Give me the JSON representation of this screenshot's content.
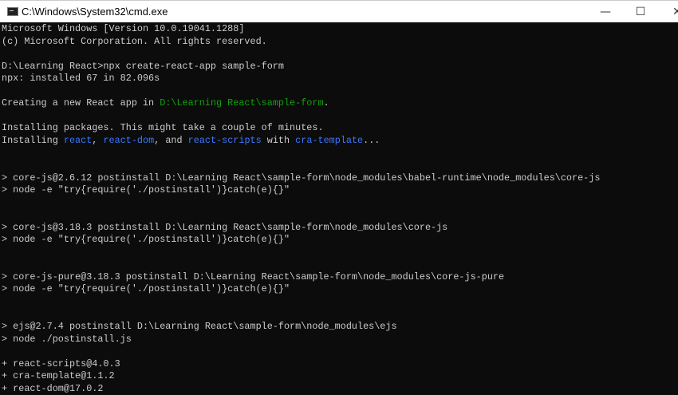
{
  "window": {
    "title": "C:\\Windows\\System32\\cmd.exe",
    "icons": [
      "cmd-icon",
      "minimize-icon",
      "maximize-icon",
      "close-icon"
    ],
    "minimize_glyph": "—",
    "maximize_glyph": "☐",
    "close_glyph": "✕"
  },
  "colors": {
    "background": "#0c0c0c",
    "text": "#cccccc",
    "green": "#13a10e",
    "blue": "#3b78ff"
  },
  "lines": [
    [
      {
        "t": "Microsoft Windows [Version 10.0.19041.1288]"
      }
    ],
    [
      {
        "t": "(c) Microsoft Corporation. All rights reserved."
      }
    ],
    [],
    [
      {
        "t": "D:\\Learning React>npx create-react-app sample-form"
      }
    ],
    [
      {
        "t": "npx: installed 67 in 82.096s"
      }
    ],
    [],
    [
      {
        "t": "Creating a new React app in "
      },
      {
        "t": "D:\\Learning React\\sample-form",
        "c": "g"
      },
      {
        "t": "."
      }
    ],
    [],
    [
      {
        "t": "Installing packages. This might take a couple of minutes."
      }
    ],
    [
      {
        "t": "Installing "
      },
      {
        "t": "react",
        "c": "b"
      },
      {
        "t": ", "
      },
      {
        "t": "react-dom",
        "c": "b"
      },
      {
        "t": ", and "
      },
      {
        "t": "react-scripts",
        "c": "b"
      },
      {
        "t": " with "
      },
      {
        "t": "cra-template",
        "c": "b"
      },
      {
        "t": "..."
      }
    ],
    [],
    [],
    [
      {
        "t": "> core-js@2.6.12 postinstall D:\\Learning React\\sample-form\\node_modules\\babel-runtime\\node_modules\\core-js"
      }
    ],
    [
      {
        "t": "> node -e \"try{require('./postinstall')}catch(e){}\""
      }
    ],
    [],
    [],
    [
      {
        "t": "> core-js@3.18.3 postinstall D:\\Learning React\\sample-form\\node_modules\\core-js"
      }
    ],
    [
      {
        "t": "> node -e \"try{require('./postinstall')}catch(e){}\""
      }
    ],
    [],
    [],
    [
      {
        "t": "> core-js-pure@3.18.3 postinstall D:\\Learning React\\sample-form\\node_modules\\core-js-pure"
      }
    ],
    [
      {
        "t": "> node -e \"try{require('./postinstall')}catch(e){}\""
      }
    ],
    [],
    [],
    [
      {
        "t": "> ejs@2.7.4 postinstall D:\\Learning React\\sample-form\\node_modules\\ejs"
      }
    ],
    [
      {
        "t": "> node ./postinstall.js"
      }
    ],
    [],
    [
      {
        "t": "+ react-scripts@4.0.3"
      }
    ],
    [
      {
        "t": "+ cra-template@1.1.2"
      }
    ],
    [
      {
        "t": "+ react-dom@17.0.2"
      }
    ]
  ]
}
